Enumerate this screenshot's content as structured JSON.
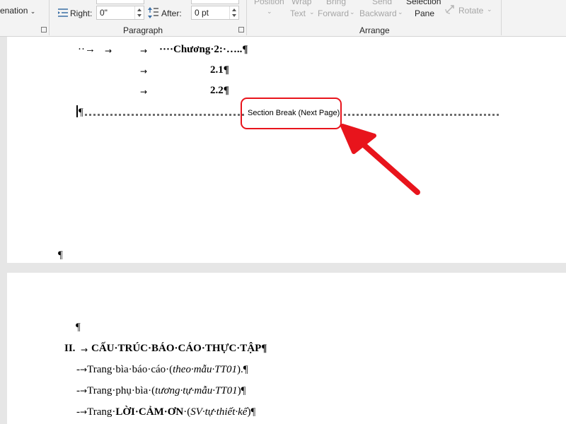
{
  "ribbon": {
    "hyphenation_partial": "enation",
    "right_label": "Right:",
    "right_value": "0\"",
    "after_label": "After:",
    "after_value": "0 pt",
    "paragraph_group": "Paragraph",
    "position_label": "Position",
    "wrap_text_label_1": "Wrap",
    "wrap_text_label_2": "Text",
    "bring_forward_label_1": "Bring",
    "bring_forward_label_2": "Forward",
    "send_backward_label_1": "Send",
    "send_backward_label_2": "Backward",
    "selection_pane_label_1": "Selection",
    "selection_pane_label_2": "Pane",
    "rotate_label": "Rotate",
    "arrange_group": "Arrange"
  },
  "page1": {
    "line1_lead": "··→",
    "line1_text": "····Chương·2:·…..¶",
    "line2_text": "2.1¶",
    "line3_text": "2.2¶",
    "pilcrow_start": "¶",
    "section_break_label": "Section Break (Next Page)",
    "end_pilcrow": "¶"
  },
  "page2": {
    "empty_pilcrow": "¶",
    "heading_num": "II.",
    "heading_text": "CẤU·TRÚC·BÁO·CÁO·THỰC·TẬP¶",
    "item1_plain": "Trang·bìa·báo·cáo·(",
    "item1_italic": "theo·mẫu·TT01",
    "item1_end": ").¶",
    "item2_plain": "Trang·phụ·bìa·(",
    "item2_italic": "tương·tự·mẫu·TT01",
    "item2_end": ")¶",
    "item3_plain": "Trang·",
    "item3_bold": "LỜI·CẢM·ƠN",
    "item3_mid": "·(",
    "item3_italic": "SV·tự·thiết·kế",
    "item3_end": ")¶"
  },
  "colors": {
    "annotation_red": "#e8141c",
    "ribbon_bg": "#f3f3f3",
    "page_bg": "#ffffff",
    "workspace_bg": "#e6e6e6"
  }
}
